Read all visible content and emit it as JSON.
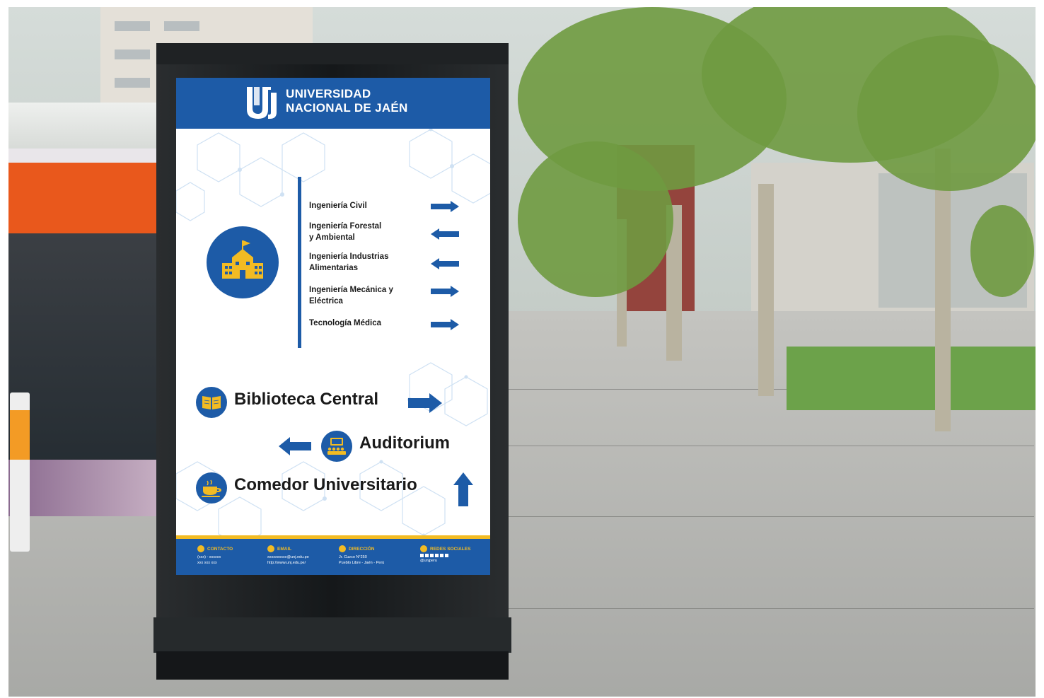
{
  "university": {
    "name_line1": "UNIVERSIDAD",
    "name_line2": "NACIONAL DE JAÉN",
    "logo_icon": "unj-logo-icon"
  },
  "programs": [
    {
      "label": "Ingeniería Civil",
      "direction": "right"
    },
    {
      "label": "Ingeniería Forestal\ny Ambiental",
      "direction": "left"
    },
    {
      "label": "Ingeniería Industrias\nAlimentarias",
      "direction": "left"
    },
    {
      "label": "Ingeniería Mecánica y\nEléctrica",
      "direction": "right"
    },
    {
      "label": "Tecnología Médica",
      "direction": "right"
    }
  ],
  "programs_icon": "school-building-icon",
  "destinations": [
    {
      "label": "Biblioteca Central",
      "icon": "book-icon",
      "direction": "right"
    },
    {
      "label": "Auditorium",
      "icon": "auditorium-icon",
      "direction": "left"
    },
    {
      "label": "Comedor Universitario",
      "icon": "coffee-cup-icon",
      "direction": "up"
    }
  ],
  "footer": {
    "contact": {
      "title": "CONTACTO",
      "lines": "(xxx) - xxxxxx\nxxx xxx xxx"
    },
    "email": {
      "title": "EMAIL",
      "lines": "xxxxxxxxxx@unj.edu.pe\nhttp://www.unj.edu.pe/"
    },
    "address": {
      "title": "DIRECCIÓN",
      "lines": "Jr. Cuzco N°250\nPueblo Libre - Jaén - Perú"
    },
    "social": {
      "title": "REDES SOCIALES",
      "lines": "@unjperu"
    }
  },
  "colors": {
    "brand_blue": "#1d5ba7",
    "accent_yellow": "#f2bb23"
  }
}
